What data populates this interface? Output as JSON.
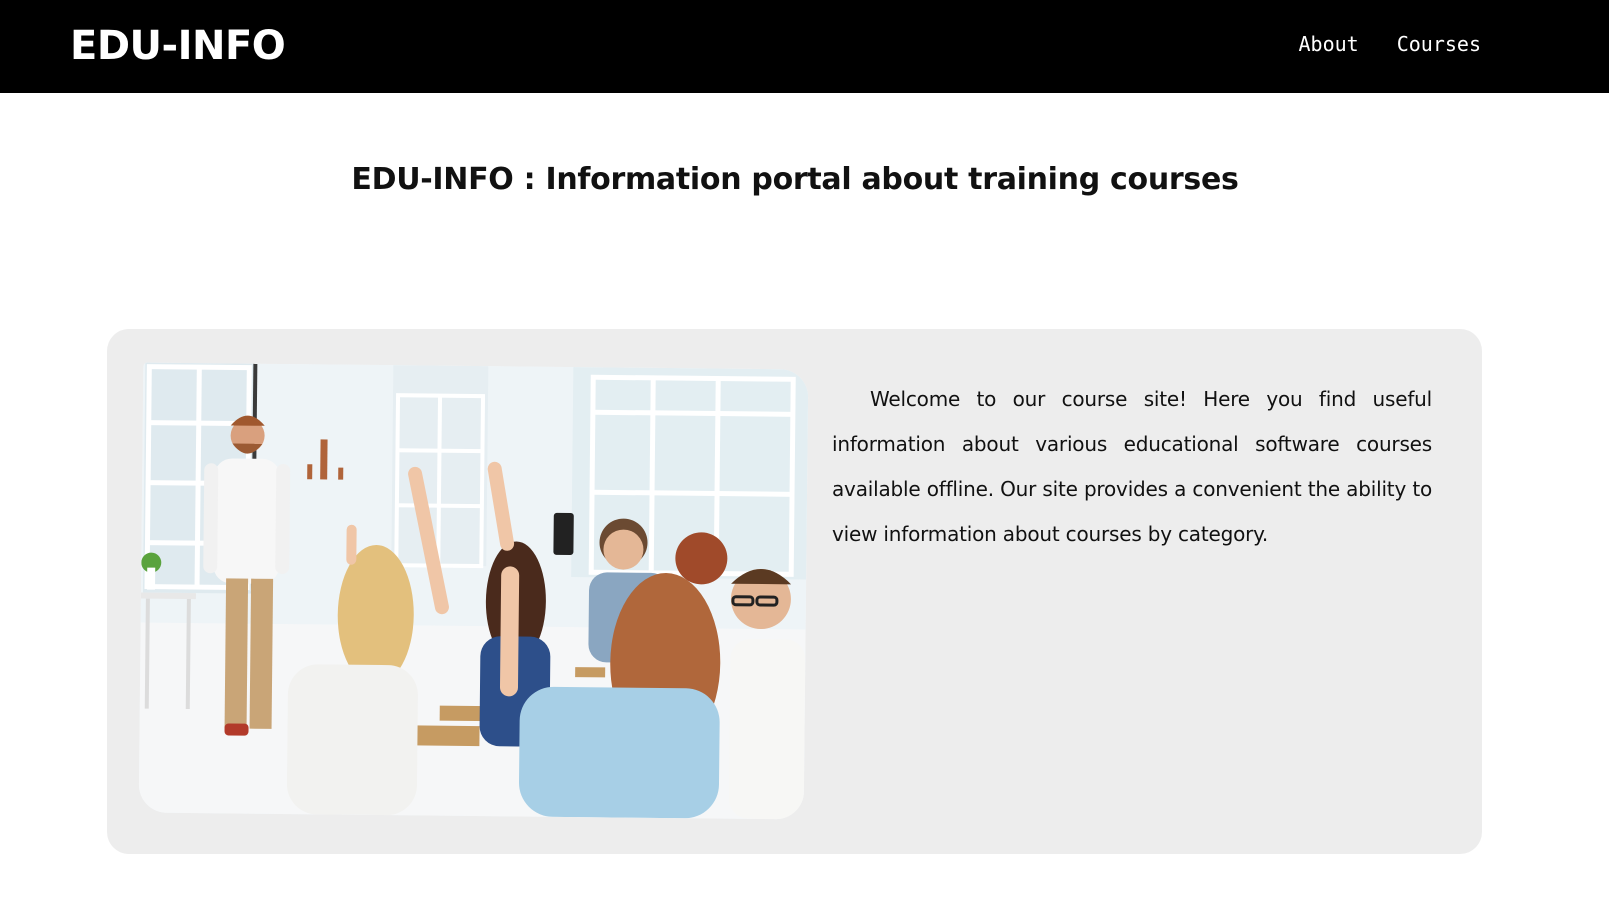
{
  "header": {
    "logo": "EDU-INFO",
    "nav": [
      {
        "label": "About"
      },
      {
        "label": "Courses"
      }
    ],
    "background_color": "#000000",
    "text_color": "#ffffff"
  },
  "main": {
    "title": "EDU-INFO : Information portal about training courses",
    "card": {
      "background_color": "#ededed",
      "image": {
        "icon": "classroom-photo"
      },
      "text": "Welcome to our course site! Here you find useful information about various educational software courses available offline. Our site provides a convenient the ability to view information about courses by category."
    }
  }
}
